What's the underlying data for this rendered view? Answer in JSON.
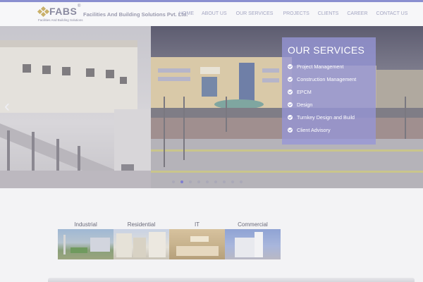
{
  "header": {
    "logo_text": "FABS",
    "logo_reg": "®",
    "logo_subtitle": "Facilities And Building Solutions",
    "company_name": "Facilities And Building Solutions Pvt. Ltd."
  },
  "nav": {
    "items": [
      {
        "label": "HOME"
      },
      {
        "label": "ABOUT US"
      },
      {
        "label": "OUR SERVICES"
      },
      {
        "label": "PROJECTS"
      },
      {
        "label": "CLIENTS"
      },
      {
        "label": "CAREER"
      },
      {
        "label": "CONTACT US"
      }
    ]
  },
  "slider": {
    "prev_arrow": "‹",
    "slide_count": 9,
    "active_index": 1
  },
  "services": {
    "title": "OUR SERVICES",
    "items": [
      {
        "label": "Project Management"
      },
      {
        "label": "Construction Management"
      },
      {
        "label": "EPCM"
      },
      {
        "label": "Design"
      },
      {
        "label": "Turnkey Design and Build"
      },
      {
        "label": "Client Advisory"
      }
    ]
  },
  "categories": [
    {
      "label": "Industrial"
    },
    {
      "label": "Residential"
    },
    {
      "label": "IT"
    },
    {
      "label": "Commercial"
    }
  ],
  "colors": {
    "accent": "#8a8fd0",
    "services_panel": "#9696d7"
  }
}
